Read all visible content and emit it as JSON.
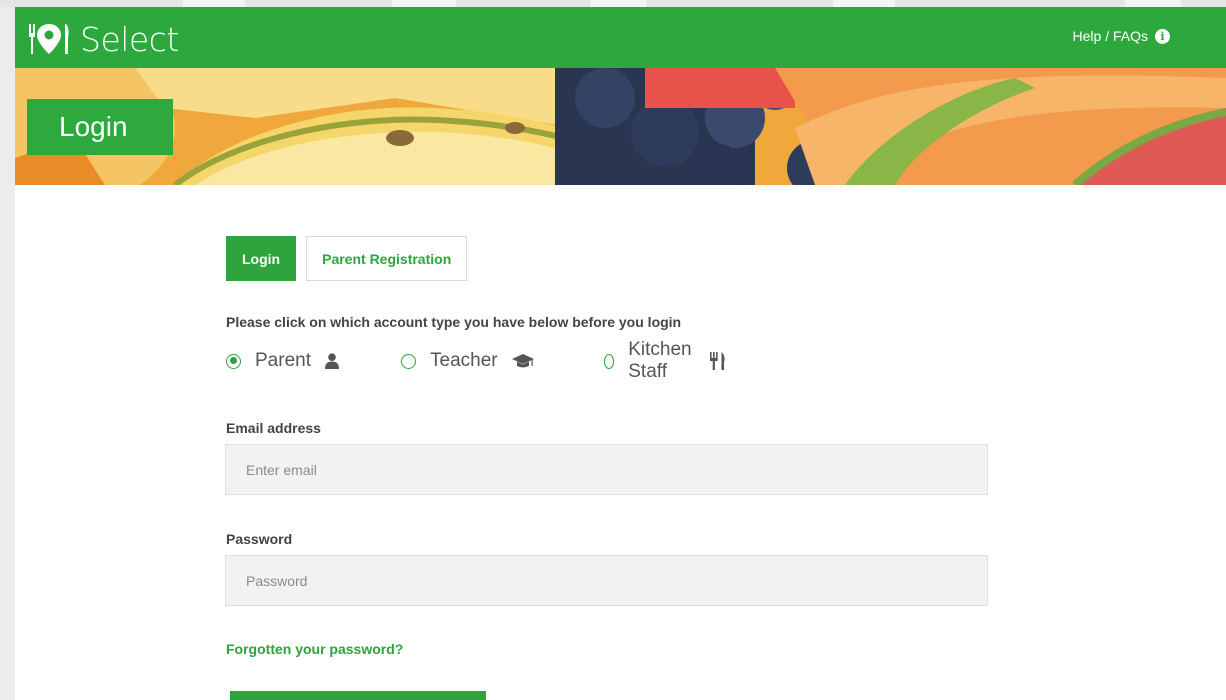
{
  "app": {
    "logo_text": "Select",
    "brand_color": "#2da83c"
  },
  "header": {
    "help_label": "Help / FAQs",
    "help_icon": "info-circle-icon"
  },
  "banner": {
    "title": "Login"
  },
  "tabs": [
    {
      "label": "Login",
      "active": true
    },
    {
      "label": "Parent Registration",
      "active": false
    }
  ],
  "account_type": {
    "instruction": "Please click on which account type you have below before you login",
    "options": [
      {
        "label": "Parent",
        "icon": "user-icon",
        "selected": true
      },
      {
        "label": "Teacher",
        "icon": "graduation-cap-icon",
        "selected": false
      },
      {
        "label": "Kitchen Staff",
        "icon": "cutlery-icon",
        "selected": false
      }
    ]
  },
  "form": {
    "email_label": "Email address",
    "email_placeholder": "Enter email",
    "email_value": "",
    "password_label": "Password",
    "password_placeholder": "Password",
    "password_value": "",
    "forgot_label": "Forgotten your password?"
  }
}
